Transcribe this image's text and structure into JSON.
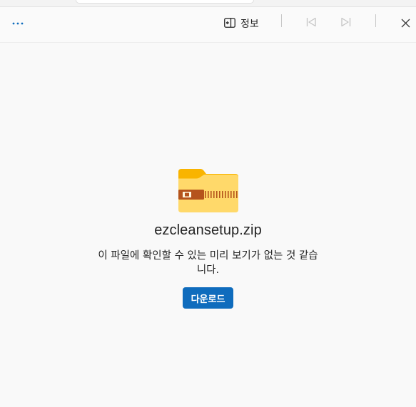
{
  "toolbar": {
    "more_icon": "more-horizontal-icon",
    "info_label": "정보",
    "info_icon": "panel-left-icon",
    "prev_icon": "skip-previous-icon",
    "next_icon": "skip-next-icon",
    "close_icon": "close-icon"
  },
  "preview": {
    "file_icon": "zip-folder-icon",
    "file_name": "ezcleansetup.zip",
    "message": "이 파일에 확인할 수 있는 미리 보기가 없는 것 같습니다.",
    "download_label": "다운로드"
  },
  "colors": {
    "accent": "#0f6cbd",
    "background": "#f9f9f9",
    "folder_front": "#ffd96a",
    "folder_back": "#f9b400",
    "zipper": "#b5541c"
  }
}
